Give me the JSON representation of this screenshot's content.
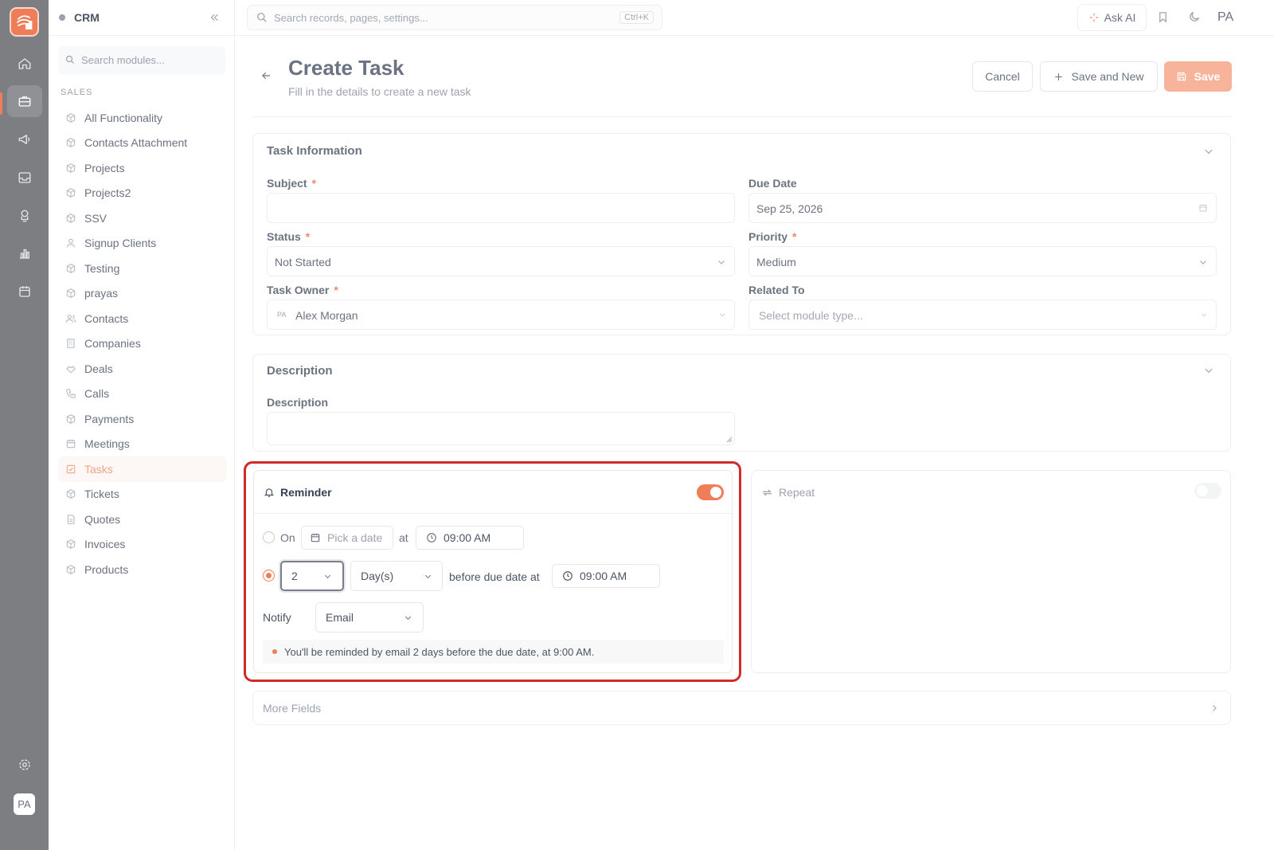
{
  "app": {
    "name": "CRM",
    "user_initials": "PA"
  },
  "colors": {
    "accent": "#ef7e58",
    "highlight": "#d22a2a",
    "rail": "#7c7e82"
  },
  "rail": [
    {
      "name": "home",
      "icon": "home-icon",
      "active": false
    },
    {
      "name": "sales",
      "icon": "briefcase-icon",
      "active": true
    },
    {
      "name": "marketing",
      "icon": "megaphone-icon",
      "active": false
    },
    {
      "name": "inbox",
      "icon": "inbox-icon",
      "active": false
    },
    {
      "name": "support",
      "icon": "headset-icon",
      "active": false
    },
    {
      "name": "analytics",
      "icon": "chart-icon",
      "active": false
    },
    {
      "name": "calendar",
      "icon": "calendar-icon",
      "active": false
    }
  ],
  "sidebar": {
    "title": "CRM",
    "search_placeholder": "Search modules...",
    "section": "SALES",
    "items": [
      {
        "label": "All Functionality",
        "icon": "box-icon"
      },
      {
        "label": "Contacts Attachment",
        "icon": "box-icon"
      },
      {
        "label": "Projects",
        "icon": "box-icon"
      },
      {
        "label": "Projects2",
        "icon": "box-icon"
      },
      {
        "label": "SSV",
        "icon": "box-icon"
      },
      {
        "label": "Signup Clients",
        "icon": "user-icon"
      },
      {
        "label": "Testing",
        "icon": "box-icon"
      },
      {
        "label": "prayas",
        "icon": "box-icon"
      },
      {
        "label": "Contacts",
        "icon": "users-icon"
      },
      {
        "label": "Companies",
        "icon": "building-icon"
      },
      {
        "label": "Deals",
        "icon": "handshake-icon"
      },
      {
        "label": "Calls",
        "icon": "phone-icon"
      },
      {
        "label": "Payments",
        "icon": "box-icon"
      },
      {
        "label": "Meetings",
        "icon": "calendar-icon"
      },
      {
        "label": "Tasks",
        "icon": "checkbox-icon",
        "active": true
      },
      {
        "label": "Tickets",
        "icon": "box-icon"
      },
      {
        "label": "Quotes",
        "icon": "document-icon"
      },
      {
        "label": "Invoices",
        "icon": "box-icon"
      },
      {
        "label": "Products",
        "icon": "box-icon"
      }
    ]
  },
  "topbar": {
    "search_placeholder": "Search records, pages, settings...",
    "shortcut": "Ctrl+K",
    "ask_ai": "Ask AI",
    "initials": "PA"
  },
  "page": {
    "title": "Create Task",
    "subtitle": "Fill in the details to create a new task",
    "cancel": "Cancel",
    "save_and_new": "Save and New",
    "save": "Save"
  },
  "task_info": {
    "title": "Task Information",
    "subject": {
      "label": "Subject",
      "value": ""
    },
    "due_date": {
      "label": "Due Date",
      "value": "Sep 25, 2026"
    },
    "status": {
      "label": "Status",
      "value": "Not Started"
    },
    "priority": {
      "label": "Priority",
      "value": "Medium"
    },
    "owner": {
      "label": "Task Owner",
      "initials": "PA",
      "value": "Alex Morgan"
    },
    "related": {
      "label": "Related To",
      "placeholder": "Select module type..."
    }
  },
  "description": {
    "title": "Description",
    "label": "Description",
    "value": ""
  },
  "reminder": {
    "title": "Reminder",
    "enabled": true,
    "on_label": "On",
    "pick_date": "Pick a date",
    "at_label": "at",
    "on_time": "09:00 AM",
    "before_value": "2",
    "unit": "Day(s)",
    "before_text": "before due date at",
    "before_time": "09:00 AM",
    "notify_label": "Notify",
    "notify_value": "Email",
    "summary": "You'll be reminded by email 2 days before the due date, at 9:00 AM."
  },
  "repeat": {
    "title": "Repeat",
    "enabled": false
  },
  "more_fields": "More Fields"
}
